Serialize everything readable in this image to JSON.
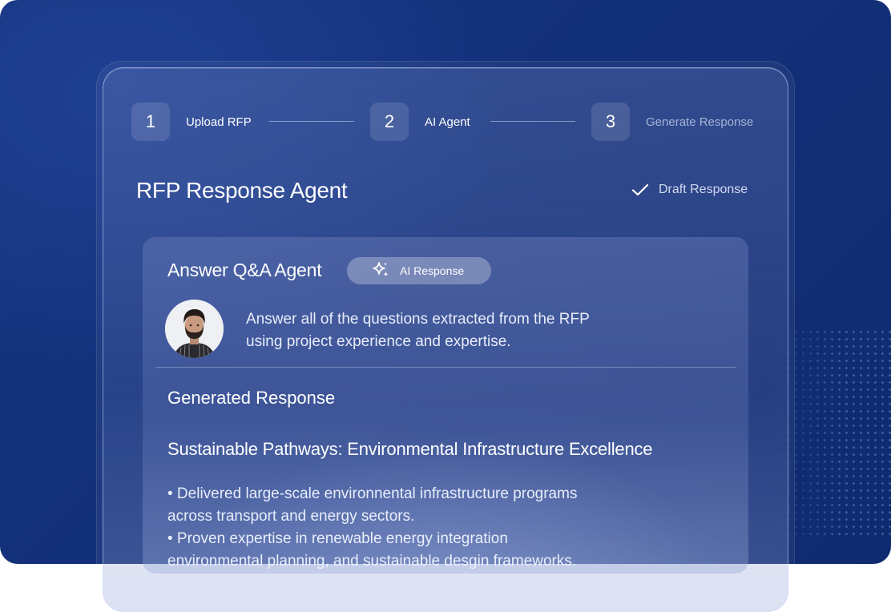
{
  "stepper": {
    "steps": [
      {
        "number": "1",
        "label": "Upload RFP"
      },
      {
        "number": "2",
        "label": "AI Agent"
      },
      {
        "number": "3",
        "label": "Generate Response"
      }
    ]
  },
  "header": {
    "title": "RFP Response Agent",
    "status_label": "Draft Response"
  },
  "agent_card": {
    "title": "Answer Q&A Agent",
    "badge_label": "AI Response",
    "intro_line1": "Answer all of the questions extracted from the RFP",
    "intro_line2": "using project experience and expertise.",
    "generated_heading": "Generated Response",
    "response_title": "Sustainable Pathways: Environmental Infrastructure Excellence",
    "bullet1_line1": "• Delivered large-scale environnental infrastructure programs",
    "bullet1_line2": "across transport and energy sectors.",
    "bullet2_line1": "• Proven expertise in renewable energy integration",
    "bullet2_line2": "environmental planning, and sustainable desgin frameworks."
  },
  "icons": {
    "check": "check-icon",
    "sparkle": "sparkle-icon",
    "avatar": "avatar"
  },
  "colors": {
    "background": "#13307a",
    "text": "#ffffff"
  }
}
